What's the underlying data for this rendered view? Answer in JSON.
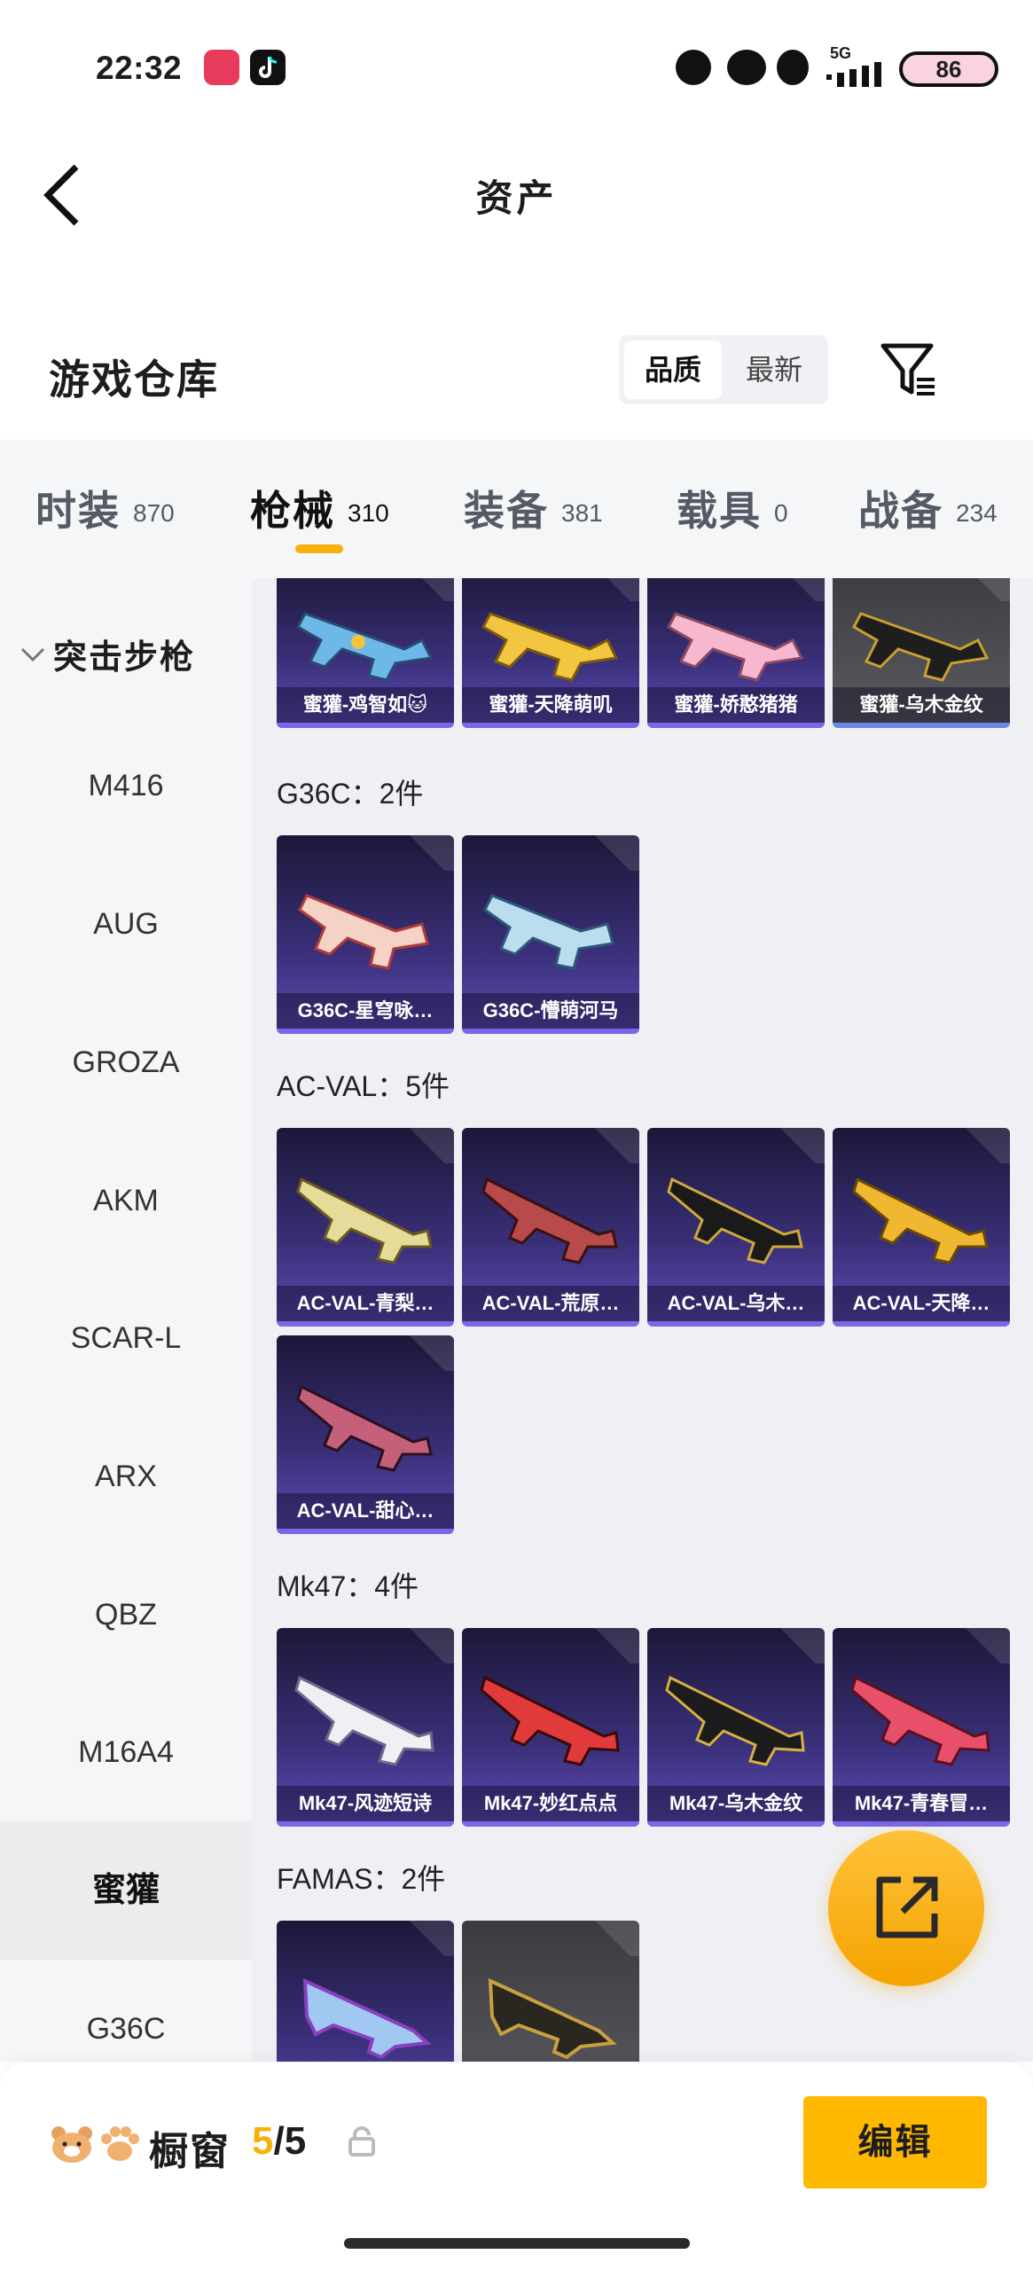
{
  "status_bar": {
    "time": "22:32",
    "network": "5G",
    "battery": "86"
  },
  "header": {
    "title": "资产"
  },
  "warehouse": {
    "title": "游戏仓库",
    "sort_options": [
      "品质",
      "最新"
    ],
    "selected_sort": "品质"
  },
  "tabs": [
    {
      "label": "时装",
      "count": "870"
    },
    {
      "label": "枪械",
      "count": "310"
    },
    {
      "label": "装备",
      "count": "381"
    },
    {
      "label": "载具",
      "count": "0"
    },
    {
      "label": "战备",
      "count": "234"
    }
  ],
  "active_tab": "枪械",
  "sidebar": {
    "category": "突击步枪",
    "items": [
      "M416",
      "AUG",
      "GROZA",
      "AKM",
      "SCAR-L",
      "ARX",
      "QBZ",
      "M16A4",
      "蜜獾",
      "G36C"
    ],
    "active_item": "蜜獾"
  },
  "sections": {
    "top_row": [
      "蜜獾-鸡智如🐱",
      "蜜獾-天降萌叽",
      "蜜獾-娇憨猪猪",
      "蜜獾-乌木金纹"
    ],
    "g36c": {
      "title": "G36C：2件",
      "items": [
        "G36C-星穹咏…",
        "G36C-懵萌河马"
      ]
    },
    "acval": {
      "title": "AC-VAL：5件",
      "items": [
        "AC-VAL-青梨…",
        "AC-VAL-荒原…",
        "AC-VAL-乌木…",
        "AC-VAL-天降…",
        "AC-VAL-甜心…"
      ]
    },
    "mk47": {
      "title": "Mk47：4件",
      "items": [
        "Mk47-风迹短诗",
        "Mk47-妙红点点",
        "Mk47-乌木金纹",
        "Mk47-青春冒…"
      ]
    },
    "famas": {
      "title": "FAMAS：2件"
    }
  },
  "bottom": {
    "showcase_label": "橱窗",
    "showcase_current": "5",
    "showcase_total": "/5",
    "edit_label": "编辑"
  },
  "colors": {
    "accent": "#f5b20a",
    "card_purple": "#3a2f78",
    "edit_button": "#ffb800"
  }
}
